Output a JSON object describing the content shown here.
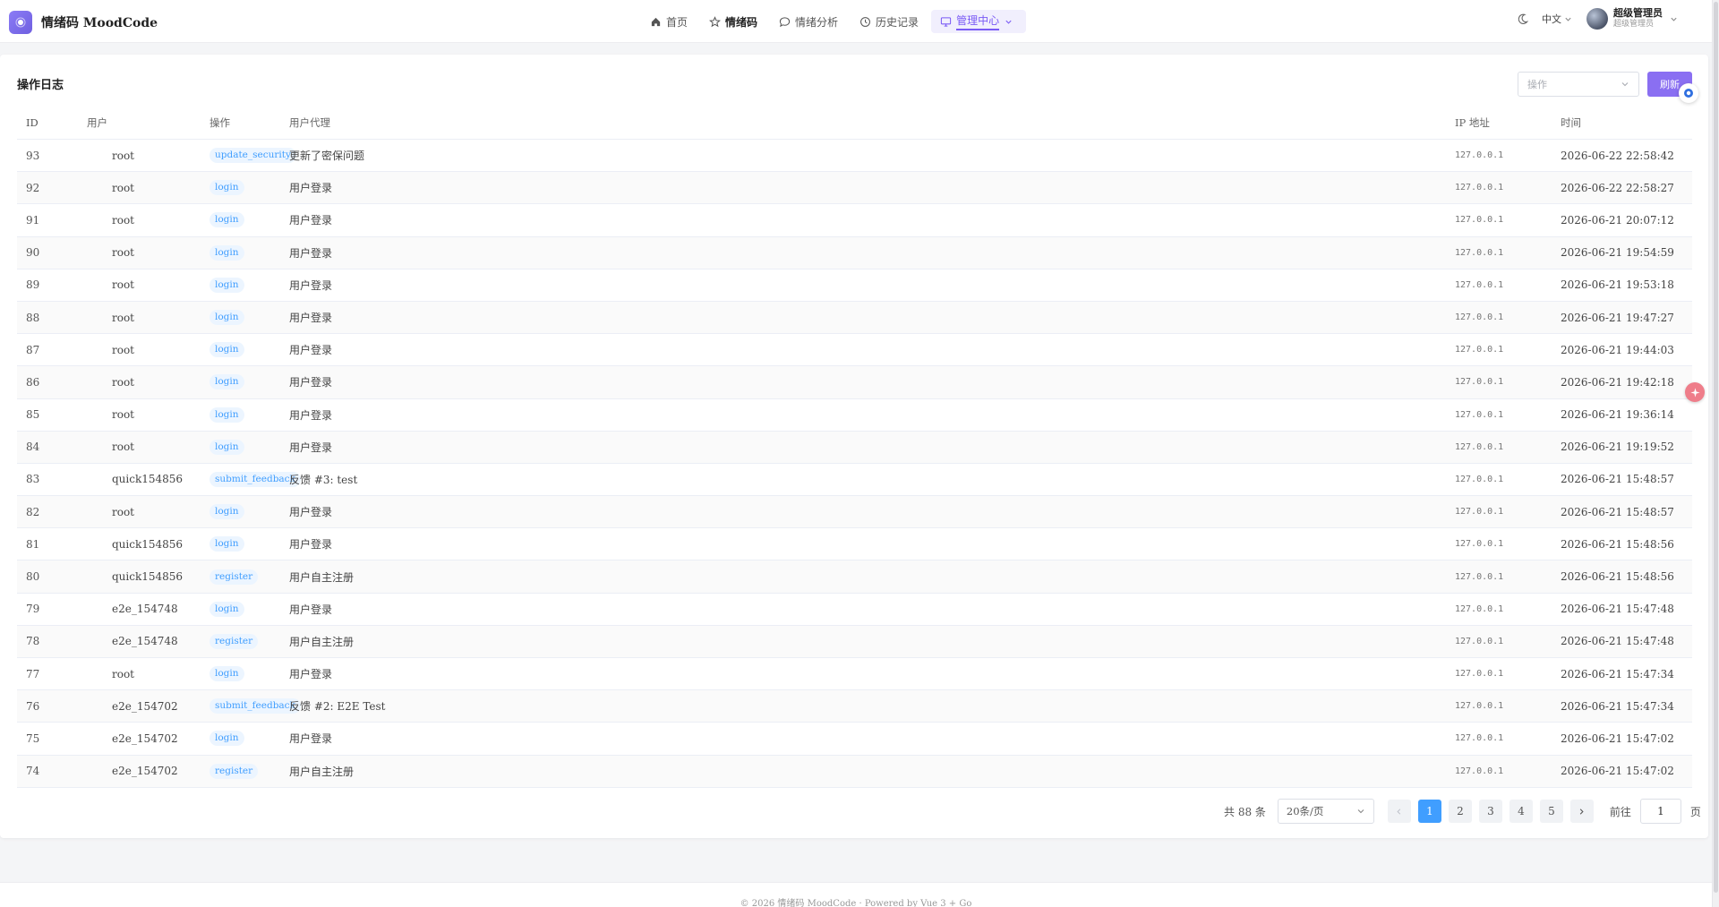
{
  "header": {
    "brand": "情绪码 MoodCode",
    "nav": [
      {
        "label": "首页",
        "icon": "home-icon"
      },
      {
        "label": "情绪码",
        "icon": "star-icon"
      },
      {
        "label": "情绪分析",
        "icon": "chat-icon"
      },
      {
        "label": "历史记录",
        "icon": "clock-icon"
      },
      {
        "label": "管理中心",
        "icon": "monitor-icon"
      }
    ],
    "language": "中文",
    "user": {
      "name": "超级管理员",
      "role": "超级管理员"
    }
  },
  "main": {
    "title": "操作日志",
    "filter_placeholder": "操作",
    "refresh_label": "刷新",
    "columns": [
      "ID",
      "用户",
      "操作",
      "用户代理",
      "IP 地址",
      "时间"
    ],
    "rows": [
      {
        "id": "93",
        "user": "root",
        "action": "update_security",
        "agent": "更新了密保问题",
        "ip": "127.0.0.1",
        "time": "2026-06-22 22:58:42"
      },
      {
        "id": "92",
        "user": "root",
        "action": "login",
        "agent": "用户登录",
        "ip": "127.0.0.1",
        "time": "2026-06-22 22:58:27"
      },
      {
        "id": "91",
        "user": "root",
        "action": "login",
        "agent": "用户登录",
        "ip": "127.0.0.1",
        "time": "2026-06-21 20:07:12"
      },
      {
        "id": "90",
        "user": "root",
        "action": "login",
        "agent": "用户登录",
        "ip": "127.0.0.1",
        "time": "2026-06-21 19:54:59"
      },
      {
        "id": "89",
        "user": "root",
        "action": "login",
        "agent": "用户登录",
        "ip": "127.0.0.1",
        "time": "2026-06-21 19:53:18"
      },
      {
        "id": "88",
        "user": "root",
        "action": "login",
        "agent": "用户登录",
        "ip": "127.0.0.1",
        "time": "2026-06-21 19:47:27"
      },
      {
        "id": "87",
        "user": "root",
        "action": "login",
        "agent": "用户登录",
        "ip": "127.0.0.1",
        "time": "2026-06-21 19:44:03"
      },
      {
        "id": "86",
        "user": "root",
        "action": "login",
        "agent": "用户登录",
        "ip": "127.0.0.1",
        "time": "2026-06-21 19:42:18"
      },
      {
        "id": "85",
        "user": "root",
        "action": "login",
        "agent": "用户登录",
        "ip": "127.0.0.1",
        "time": "2026-06-21 19:36:14"
      },
      {
        "id": "84",
        "user": "root",
        "action": "login",
        "agent": "用户登录",
        "ip": "127.0.0.1",
        "time": "2026-06-21 19:19:52"
      },
      {
        "id": "83",
        "user": "quick154856",
        "action": "submit_feedback",
        "agent": "反馈 #3: test",
        "ip": "127.0.0.1",
        "time": "2026-06-21 15:48:57"
      },
      {
        "id": "82",
        "user": "root",
        "action": "login",
        "agent": "用户登录",
        "ip": "127.0.0.1",
        "time": "2026-06-21 15:48:57"
      },
      {
        "id": "81",
        "user": "quick154856",
        "action": "login",
        "agent": "用户登录",
        "ip": "127.0.0.1",
        "time": "2026-06-21 15:48:56"
      },
      {
        "id": "80",
        "user": "quick154856",
        "action": "register",
        "agent": "用户自主注册",
        "ip": "127.0.0.1",
        "time": "2026-06-21 15:48:56"
      },
      {
        "id": "79",
        "user": "e2e_154748",
        "action": "login",
        "agent": "用户登录",
        "ip": "127.0.0.1",
        "time": "2026-06-21 15:47:48"
      },
      {
        "id": "78",
        "user": "e2e_154748",
        "action": "register",
        "agent": "用户自主注册",
        "ip": "127.0.0.1",
        "time": "2026-06-21 15:47:48"
      },
      {
        "id": "77",
        "user": "root",
        "action": "login",
        "agent": "用户登录",
        "ip": "127.0.0.1",
        "time": "2026-06-21 15:47:34"
      },
      {
        "id": "76",
        "user": "e2e_154702",
        "action": "submit_feedback",
        "agent": "反馈 #2: E2E Test",
        "ip": "127.0.0.1",
        "time": "2026-06-21 15:47:34"
      },
      {
        "id": "75",
        "user": "e2e_154702",
        "action": "login",
        "agent": "用户登录",
        "ip": "127.0.0.1",
        "time": "2026-06-21 15:47:02"
      },
      {
        "id": "74",
        "user": "e2e_154702",
        "action": "register",
        "agent": "用户自主注册",
        "ip": "127.0.0.1",
        "time": "2026-06-21 15:47:02"
      }
    ]
  },
  "pagination": {
    "total": "共 88 条",
    "page_size": "20条/页",
    "pages": [
      "1",
      "2",
      "3",
      "4",
      "5"
    ],
    "current": "1",
    "goto_label": "前往",
    "goto_value": "1",
    "page_suffix": "页"
  },
  "footer": {
    "text": "© 2026 情绪码 MoodCode · Powered by Vue 3 + Go"
  },
  "colors": {
    "accent": "#8a6ff2",
    "tag_bg": "#ecf5ff",
    "tag_text": "#409eff",
    "page_active": "#409eff"
  }
}
